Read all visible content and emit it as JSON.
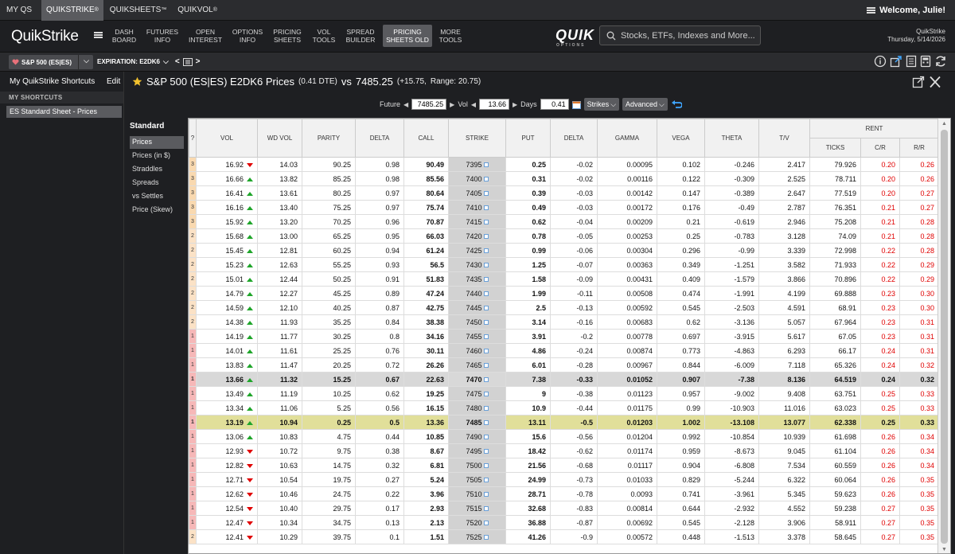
{
  "topnav": {
    "items": [
      {
        "label": "MY QS",
        "tm": ""
      },
      {
        "label": "QUIKSTRIKE",
        "tm": "®"
      },
      {
        "label": "QUIKSHEETS",
        "tm": "™"
      },
      {
        "label": "QUIKVOL",
        "tm": "®"
      }
    ],
    "welcome": "Welcome, Julie!"
  },
  "mainnav": {
    "logo": "QuikStrike",
    "items": [
      {
        "line1": "DASH",
        "line2": "BOARD"
      },
      {
        "line1": "FUTURES",
        "line2": "INFO"
      },
      {
        "line1": "OPEN",
        "line2": "INTEREST"
      },
      {
        "line1": "OPTIONS",
        "line2": "INFO"
      },
      {
        "line1": "PRICING",
        "line2": "SHEETS"
      },
      {
        "line1": "VOL",
        "line2": "TOOLS"
      },
      {
        "line1": "SPREAD",
        "line2": "BUILDER"
      },
      {
        "line1": "PRICING",
        "line2": "SHEETS OLD"
      },
      {
        "line1": "MORE",
        "line2": "TOOLS"
      }
    ],
    "brand": "QUIK",
    "brand_sub": "OPTIONS",
    "search_placeholder": "Stocks, ETFs, Indexes and More...",
    "app_name": "QuikStrike",
    "date": "Thursday, 5/14/2026"
  },
  "secbar": {
    "product": "S&P 500 (ES|ES)",
    "expiration_label": "EXPIRATION: E2DK6"
  },
  "sidebar": {
    "heading": "My QuikStrike Shortcuts",
    "edit": "Edit",
    "sub": "MY SHORTCUTS",
    "item": "ES Standard Sheet - Prices"
  },
  "content": {
    "title_main": "S&P 500 (ES|ES) E2DK6 Prices",
    "title_dte": "(0.41 DTE)",
    "title_vs": "vs",
    "title_price": "7485.25",
    "title_change": "(+15.75,",
    "title_range": "Range: 20.75)",
    "controls": {
      "future_label": "Future",
      "future_value": "7485.25",
      "vol_label": "Vol",
      "vol_value": "13.66",
      "days_label": "Days",
      "days_value": "0.41",
      "strikes_btn": "Strikes",
      "advanced_btn": "Advanced"
    },
    "standard": "Standard",
    "left_options": [
      "Prices",
      "Prices (in $)",
      "Straddles",
      "Spreads",
      "vs Settles",
      "Price (Skew)"
    ]
  },
  "table": {
    "headers": {
      "rank": "?",
      "vol": "VOL",
      "wdvol": "WD VOL",
      "parity": "PARITY",
      "delta_c": "DELTA",
      "call": "CALL",
      "strike": "STRIKE",
      "put": "PUT",
      "delta_p": "DELTA",
      "gamma": "GAMMA",
      "vega": "VEGA",
      "theta": "THETA",
      "tv": "T/V",
      "rent": "RENT",
      "ticks": "TICKS",
      "cr": "C/R",
      "rr": "R/R"
    },
    "rows": [
      [
        "3",
        "16.92",
        "dn",
        "14.03",
        "90.25",
        "0.98",
        "90.49",
        "7395",
        "0.25",
        "-0.02",
        "0.00095",
        "0.102",
        "-0.246",
        "2.417",
        "79.926",
        "0.20",
        "0.26"
      ],
      [
        "3",
        "16.66",
        "up",
        "13.82",
        "85.25",
        "0.98",
        "85.56",
        "7400",
        "0.31",
        "-0.02",
        "0.00116",
        "0.122",
        "-0.309",
        "2.525",
        "78.711",
        "0.20",
        "0.26"
      ],
      [
        "3",
        "16.41",
        "up",
        "13.61",
        "80.25",
        "0.97",
        "80.64",
        "7405",
        "0.39",
        "-0.03",
        "0.00142",
        "0.147",
        "-0.389",
        "2.647",
        "77.519",
        "0.20",
        "0.27"
      ],
      [
        "3",
        "16.16",
        "up",
        "13.40",
        "75.25",
        "0.97",
        "75.74",
        "7410",
        "0.49",
        "-0.03",
        "0.00172",
        "0.176",
        "-0.49",
        "2.787",
        "76.351",
        "0.21",
        "0.27"
      ],
      [
        "3",
        "15.92",
        "up",
        "13.20",
        "70.25",
        "0.96",
        "70.87",
        "7415",
        "0.62",
        "-0.04",
        "0.00209",
        "0.21",
        "-0.619",
        "2.946",
        "75.208",
        "0.21",
        "0.28"
      ],
      [
        "2",
        "15.68",
        "up",
        "13.00",
        "65.25",
        "0.95",
        "66.03",
        "7420",
        "0.78",
        "-0.05",
        "0.00253",
        "0.25",
        "-0.783",
        "3.128",
        "74.09",
        "0.21",
        "0.28"
      ],
      [
        "2",
        "15.45",
        "up",
        "12.81",
        "60.25",
        "0.94",
        "61.24",
        "7425",
        "0.99",
        "-0.06",
        "0.00304",
        "0.296",
        "-0.99",
        "3.339",
        "72.998",
        "0.22",
        "0.28"
      ],
      [
        "2",
        "15.23",
        "up",
        "12.63",
        "55.25",
        "0.93",
        "56.5",
        "7430",
        "1.25",
        "-0.07",
        "0.00363",
        "0.349",
        "-1.251",
        "3.582",
        "71.933",
        "0.22",
        "0.29"
      ],
      [
        "2",
        "15.01",
        "up",
        "12.44",
        "50.25",
        "0.91",
        "51.83",
        "7435",
        "1.58",
        "-0.09",
        "0.00431",
        "0.409",
        "-1.579",
        "3.866",
        "70.896",
        "0.22",
        "0.29"
      ],
      [
        "2",
        "14.79",
        "up",
        "12.27",
        "45.25",
        "0.89",
        "47.24",
        "7440",
        "1.99",
        "-0.11",
        "0.00508",
        "0.474",
        "-1.991",
        "4.199",
        "69.888",
        "0.23",
        "0.30"
      ],
      [
        "2",
        "14.59",
        "up",
        "12.10",
        "40.25",
        "0.87",
        "42.75",
        "7445",
        "2.5",
        "-0.13",
        "0.00592",
        "0.545",
        "-2.503",
        "4.591",
        "68.91",
        "0.23",
        "0.30"
      ],
      [
        "2",
        "14.38",
        "up",
        "11.93",
        "35.25",
        "0.84",
        "38.38",
        "7450",
        "3.14",
        "-0.16",
        "0.00683",
        "0.62",
        "-3.136",
        "5.057",
        "67.964",
        "0.23",
        "0.31"
      ],
      [
        "1",
        "14.19",
        "up",
        "11.77",
        "30.25",
        "0.8",
        "34.16",
        "7455",
        "3.91",
        "-0.2",
        "0.00778",
        "0.697",
        "-3.915",
        "5.617",
        "67.05",
        "0.23",
        "0.31"
      ],
      [
        "1",
        "14.01",
        "up",
        "11.61",
        "25.25",
        "0.76",
        "30.11",
        "7460",
        "4.86",
        "-0.24",
        "0.00874",
        "0.773",
        "-4.863",
        "6.293",
        "66.17",
        "0.24",
        "0.31"
      ],
      [
        "1",
        "13.83",
        "up",
        "11.47",
        "20.25",
        "0.72",
        "26.26",
        "7465",
        "6.01",
        "-0.28",
        "0.00967",
        "0.844",
        "-6.009",
        "7.118",
        "65.326",
        "0.24",
        "0.32"
      ],
      [
        "1",
        "13.66",
        "up",
        "11.32",
        "15.25",
        "0.67",
        "22.63",
        "7470",
        "7.38",
        "-0.33",
        "0.01052",
        "0.907",
        "-7.38",
        "8.136",
        "64.519",
        "0.24",
        "0.32"
      ],
      [
        "1",
        "13.49",
        "up",
        "11.19",
        "10.25",
        "0.62",
        "19.25",
        "7475",
        "9",
        "-0.38",
        "0.01123",
        "0.957",
        "-9.002",
        "9.408",
        "63.751",
        "0.25",
        "0.33"
      ],
      [
        "1",
        "13.34",
        "up",
        "11.06",
        "5.25",
        "0.56",
        "16.15",
        "7480",
        "10.9",
        "-0.44",
        "0.01175",
        "0.99",
        "-10.903",
        "11.016",
        "63.023",
        "0.25",
        "0.33"
      ],
      [
        "1",
        "13.19",
        "up",
        "10.94",
        "0.25",
        "0.5",
        "13.36",
        "7485",
        "13.11",
        "-0.5",
        "0.01203",
        "1.002",
        "-13.108",
        "13.077",
        "62.338",
        "0.25",
        "0.33"
      ],
      [
        "1",
        "13.06",
        "up",
        "10.83",
        "4.75",
        "0.44",
        "10.85",
        "7490",
        "15.6",
        "-0.56",
        "0.01204",
        "0.992",
        "-10.854",
        "10.939",
        "61.698",
        "0.26",
        "0.34"
      ],
      [
        "1",
        "12.93",
        "dn",
        "10.72",
        "9.75",
        "0.38",
        "8.67",
        "7495",
        "18.42",
        "-0.62",
        "0.01174",
        "0.959",
        "-8.673",
        "9.045",
        "61.104",
        "0.26",
        "0.34"
      ],
      [
        "1",
        "12.82",
        "dn",
        "10.63",
        "14.75",
        "0.32",
        "6.81",
        "7500",
        "21.56",
        "-0.68",
        "0.01117",
        "0.904",
        "-6.808",
        "7.534",
        "60.559",
        "0.26",
        "0.34"
      ],
      [
        "1",
        "12.71",
        "dn",
        "10.54",
        "19.75",
        "0.27",
        "5.24",
        "7505",
        "24.99",
        "-0.73",
        "0.01033",
        "0.829",
        "-5.244",
        "6.322",
        "60.064",
        "0.26",
        "0.35"
      ],
      [
        "1",
        "12.62",
        "dn",
        "10.46",
        "24.75",
        "0.22",
        "3.96",
        "7510",
        "28.71",
        "-0.78",
        "0.0093",
        "0.741",
        "-3.961",
        "5.345",
        "59.623",
        "0.26",
        "0.35"
      ],
      [
        "1",
        "12.54",
        "dn",
        "10.40",
        "29.75",
        "0.17",
        "2.93",
        "7515",
        "32.68",
        "-0.83",
        "0.00814",
        "0.644",
        "-2.932",
        "4.552",
        "59.238",
        "0.27",
        "0.35"
      ],
      [
        "1",
        "12.47",
        "dn",
        "10.34",
        "34.75",
        "0.13",
        "2.13",
        "7520",
        "36.88",
        "-0.87",
        "0.00692",
        "0.545",
        "-2.128",
        "3.906",
        "58.911",
        "0.27",
        "0.35"
      ],
      [
        "2",
        "12.41",
        "dn",
        "10.29",
        "39.75",
        "0.1",
        "1.51",
        "7525",
        "41.26",
        "-0.9",
        "0.00572",
        "0.448",
        "-1.513",
        "3.378",
        "58.645",
        "0.27",
        "0.35"
      ]
    ]
  }
}
